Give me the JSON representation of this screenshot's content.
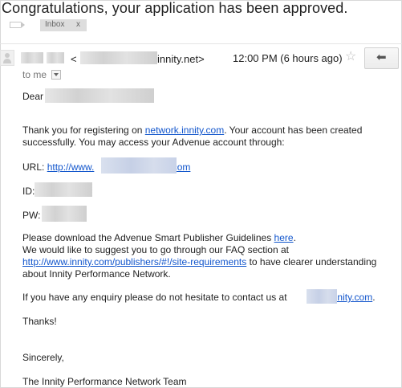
{
  "email": {
    "subject": "Congratulations, your application has been approved.",
    "label": {
      "name": "Inbox",
      "remove": "x"
    },
    "sender": {
      "open_bracket": "<",
      "email_suffix": "innity.net>"
    },
    "time": "12:00 PM (6 hours ago)",
    "star_icon": "star-icon",
    "reply_icon": "reply-icon",
    "to": "to me",
    "body": {
      "greeting": "Dear",
      "p1_a": "Thank you for registering on ",
      "p1_link": "network.innity.com",
      "p1_b": ". Your account has been created",
      "p1_c": "successfully. You may access your Advenue account through:",
      "url_label": "URL: ",
      "url_link_a": "http://www.",
      "url_link_b": ".com",
      "id_label": "ID:",
      "pw_label": "PW:",
      "p2_a": "Please download the Advenue Smart Publisher Guidelines ",
      "p2_link": "here",
      "p2_b": ".",
      "p3_a": "We would like to suggest you to go through our FAQ section at",
      "p3_link": "http://www.innity.com/publishers/#!/site-requirements",
      "p3_b": " to have clearer understanding",
      "p3_c": "about Innity Performance Network.",
      "p4_a": "If you have any enquiry please do not hesitate to contact us at ",
      "p4_link": "@innity.com",
      "p4_b": ".",
      "thanks": "Thanks!",
      "sincerely": "Sincerely,",
      "signature": "The Innity Performance Network Team"
    }
  }
}
